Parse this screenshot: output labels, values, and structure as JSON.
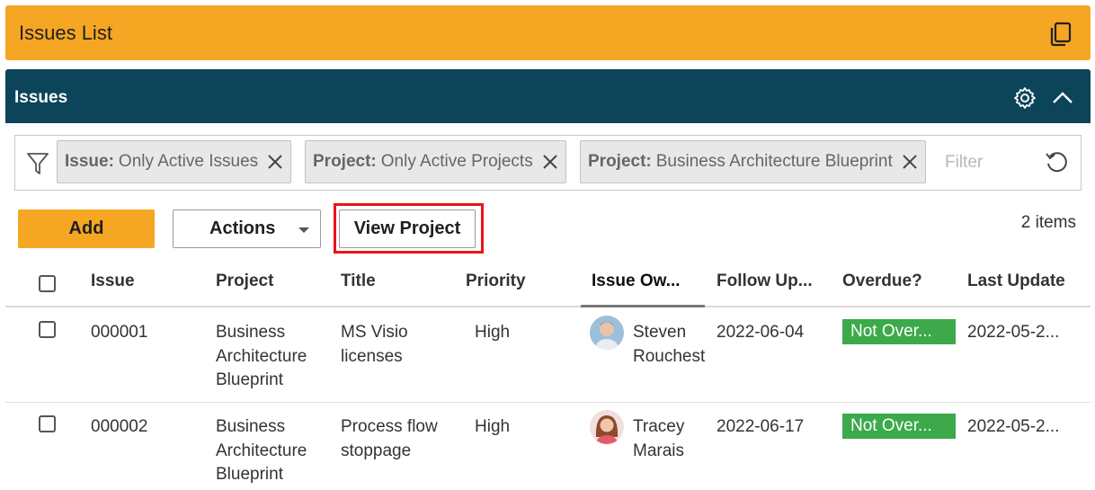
{
  "app": {
    "title": "Issues List"
  },
  "panel": {
    "title": "Issues"
  },
  "filters": {
    "chips": [
      {
        "key": "Issue:",
        "value": "Only Active Issues"
      },
      {
        "key": "Project:",
        "value": "Only Active Projects"
      },
      {
        "key": "Project:",
        "value": "Business Architecture Blueprint"
      }
    ],
    "placeholder": "Filter"
  },
  "toolbar": {
    "add_label": "Add",
    "actions_label": "Actions",
    "view_project_label": "View Project",
    "item_count": "2 items"
  },
  "table": {
    "columns": [
      "Issue",
      "Project",
      "Title",
      "Priority",
      "Issue Ow...",
      "Follow Up...",
      "Overdue?",
      "Last Update"
    ],
    "rows": [
      {
        "issue": "000001",
        "project": [
          "Business",
          "Architecture",
          "Blueprint"
        ],
        "title": [
          "MS Visio",
          "licenses"
        ],
        "priority": "High",
        "owner": [
          "Steven",
          "Rouchest"
        ],
        "follow_up": "2022-06-04",
        "overdue": "Not Over...",
        "last_update": "2022-05-2..."
      },
      {
        "issue": "000002",
        "project": [
          "Business",
          "Architecture",
          "Blueprint"
        ],
        "title": [
          "Process flow",
          "stoppage"
        ],
        "priority": "High",
        "owner": [
          "Tracey",
          "Marais"
        ],
        "follow_up": "2022-06-17",
        "overdue": "Not Over...",
        "last_update": "2022-05-2..."
      }
    ]
  },
  "colors": {
    "title_bar": "#f5a623",
    "panel_header": "#0c4459",
    "overdue_badge": "#3ca94a",
    "highlight": "#e8141c"
  },
  "icons": [
    "copy-icon",
    "gear-icon",
    "chevron-up-icon",
    "filter-icon",
    "close-icon",
    "reset-icon",
    "caret-down-icon",
    "avatar"
  ]
}
